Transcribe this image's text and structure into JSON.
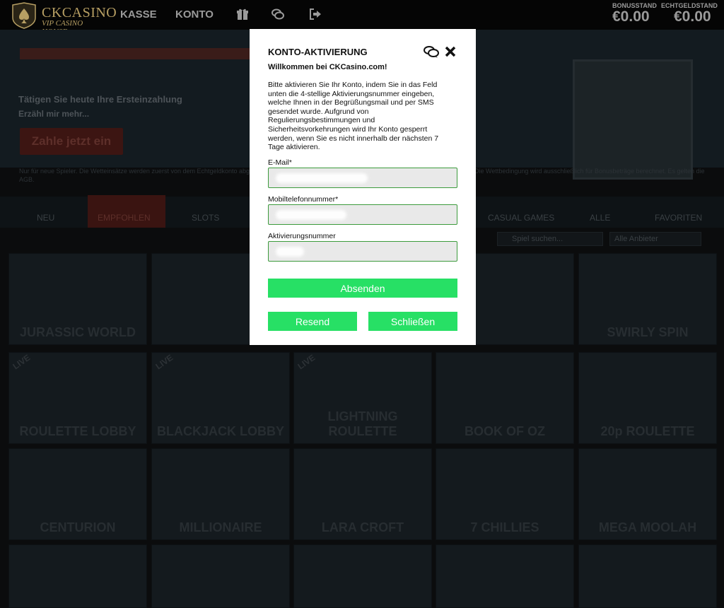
{
  "header": {
    "logo_name": "CKCASINO",
    "logo_tagline": "VIP CASINO HOUSE",
    "nav": [
      "KASSE",
      "KONTO"
    ],
    "icons": [
      "gift-icon",
      "chat-icon",
      "logout-icon"
    ],
    "bonus_label": "BONUSSTAND",
    "bonus_value": "€0.00",
    "real_label": "ECHTGELDSTAND",
    "real_value": "€0.00"
  },
  "background": {
    "hero_sub1": "Tätigen Sie heute Ihre Ersteinzahlung",
    "hero_sub2": "Erzähl mir mehr...",
    "hero_cta": "Zahle jetzt ein",
    "fineprint": "Nur für neue Spieler. Die Wetteinsätze werden zuerst von dem Echtgeldkonto abgezogen. Der Bonus ist für 30 Tage gültig. Nur für ausgewählte Spiele verfügbar. Die Wettbedingung wird ausschließlich für Bonusbeträge berechnet. Es gelten die AGB.",
    "categories": [
      "NEU",
      "EMPFOHLEN",
      "SLOTS",
      "CASUAL GAMES",
      "ALLE",
      "FAVORITEN"
    ],
    "search_placeholder": "Spiel suchen...",
    "provider_filter": "Alle Anbieter",
    "tiles_row1": [
      "JURASSIC WORLD",
      "",
      "",
      "",
      "",
      "SWIRLY SPIN"
    ],
    "tiles_row2": [
      "ROULETTE LOBBY",
      "BLACKJACK LOBBY",
      "LIGHTNING ROULETTE",
      "BOOK OF OZ",
      "20p ROULETTE"
    ],
    "tiles_row3": [
      "CENTURION",
      "MILLIONAIRE",
      "LARA CROFT",
      "7 CHILLIES",
      "MEGA MOOLAH"
    ],
    "live_badge": "LIVE"
  },
  "modal": {
    "title": "KONTO-AKTIVIERUNG",
    "welcome": "Willkommen bei CKCasino.com!",
    "description": "Bitte aktivieren Sie Ihr Konto, indem Sie in das Feld unten die 4-stellige Aktivierungsnummer eingeben, welche Ihnen in der Begrüßungsmail und per SMS gesendet wurde. Aufgrund von Regulierungsbestimmungen und Sicherheitsvorkehrungen wird Ihr Konto gesperrt werden, wenn Sie es nicht innerhalb der nächsten 7 Tage aktivieren.",
    "email_label": "E-Mail*",
    "phone_label": "Mobiltelefonnummer*",
    "code_label": "Aktivierungsnummer",
    "submit": "Absenden",
    "resend": "Resend",
    "close": "Schließen"
  },
  "colors": {
    "accent_green": "#27e065",
    "field_border": "#3c9b3c",
    "logo_gold": "#b79f63"
  }
}
